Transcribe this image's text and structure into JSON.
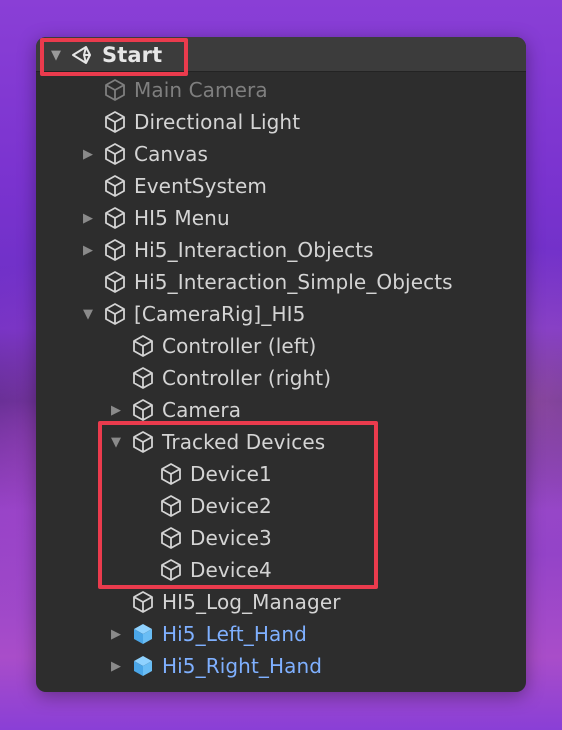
{
  "scene": {
    "name": "Start",
    "expanded": true
  },
  "hierarchy": [
    {
      "label": "Main Camera",
      "icon": "gameobject-cube-icon",
      "state": "disabled",
      "has_children": false
    },
    {
      "label": "Directional Light",
      "icon": "gameobject-cube-icon",
      "state": "normal",
      "has_children": false
    },
    {
      "label": "Canvas",
      "icon": "gameobject-cube-icon",
      "state": "normal",
      "has_children": true,
      "expanded": false
    },
    {
      "label": "EventSystem",
      "icon": "gameobject-cube-icon",
      "state": "normal",
      "has_children": false
    },
    {
      "label": "HI5 Menu",
      "icon": "gameobject-cube-icon",
      "state": "normal",
      "has_children": true,
      "expanded": false
    },
    {
      "label": "Hi5_Interaction_Objects",
      "icon": "gameobject-cube-icon",
      "state": "normal",
      "has_children": true,
      "expanded": false
    },
    {
      "label": "Hi5_Interaction_Simple_Objects",
      "icon": "gameobject-cube-icon",
      "state": "normal",
      "has_children": false
    },
    {
      "label": "[CameraRig]_HI5",
      "icon": "gameobject-cube-icon",
      "state": "normal",
      "has_children": true,
      "expanded": true
    },
    {
      "label": "Controller (left)",
      "icon": "gameobject-cube-icon",
      "state": "normal",
      "has_children": false
    },
    {
      "label": "Controller (right)",
      "icon": "gameobject-cube-icon",
      "state": "normal",
      "has_children": false
    },
    {
      "label": "Camera",
      "icon": "gameobject-cube-icon",
      "state": "normal",
      "has_children": true,
      "expanded": false
    },
    {
      "label": "Tracked Devices",
      "icon": "gameobject-cube-icon",
      "state": "normal",
      "has_children": true,
      "expanded": true
    },
    {
      "label": "Device1",
      "icon": "gameobject-cube-icon",
      "state": "normal",
      "has_children": false
    },
    {
      "label": "Device2",
      "icon": "gameobject-cube-icon",
      "state": "normal",
      "has_children": false
    },
    {
      "label": "Device3",
      "icon": "gameobject-cube-icon",
      "state": "normal",
      "has_children": false
    },
    {
      "label": "Device4",
      "icon": "gameobject-cube-icon",
      "state": "normal",
      "has_children": false
    },
    {
      "label": "HI5_Log_Manager",
      "icon": "gameobject-cube-icon",
      "state": "normal",
      "has_children": false
    },
    {
      "label": "Hi5_Left_Hand",
      "icon": "prefab-cube-icon",
      "state": "prefab",
      "has_children": true,
      "expanded": false
    },
    {
      "label": "Hi5_Right_Hand",
      "icon": "prefab-cube-icon",
      "state": "prefab",
      "has_children": true,
      "expanded": false
    }
  ],
  "colors": {
    "highlight": "#ea3b4d",
    "prefab": "#7fb0ff",
    "text": "#d4d4d4",
    "disabled": "#7f7f7f"
  }
}
